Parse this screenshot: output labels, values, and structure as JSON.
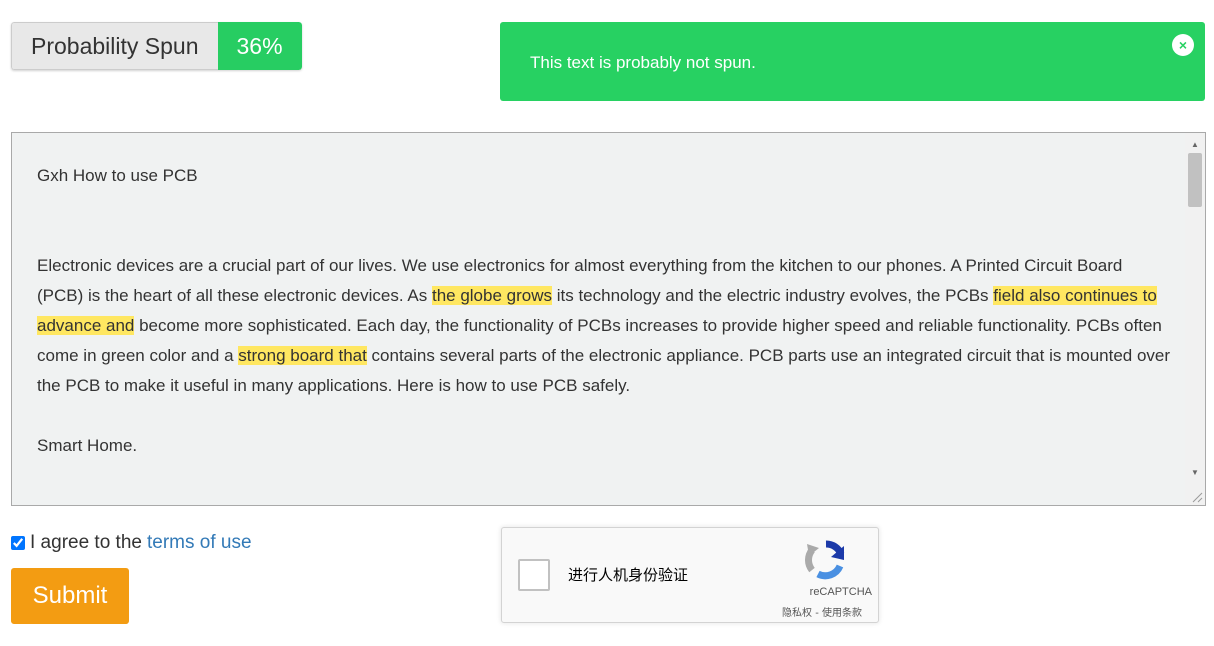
{
  "probability": {
    "label": "Probability Spun",
    "value": "36%"
  },
  "alert": {
    "message": "This text is probably not spun.",
    "close_symbol": "×",
    "color": "#27d162"
  },
  "textbox": {
    "title": "Gxh  How to use PCB",
    "paragraph_segments": [
      {
        "text": "Electronic devices are a crucial part of our lives. We use electronics for almost everything from the kitchen to our phones. A Printed Circuit Board (PCB) is the heart of all these electronic devices. As ",
        "highlight": false
      },
      {
        "text": "the globe grows",
        "highlight": true
      },
      {
        "text": " its technology and the electric industry evolves, the PCBs ",
        "highlight": false
      },
      {
        "text": "field also continues to advance and",
        "highlight": true
      },
      {
        "text": " become more sophisticated. Each day, the functionality of PCBs increases to provide higher speed and reliable functionality. PCBs often come in green color and a ",
        "highlight": false
      },
      {
        "text": "strong board that",
        "highlight": true
      },
      {
        "text": " contains several parts of the electronic appliance. PCB parts use an integrated circuit that is mounted over the PCB to make it useful in many applications. Here is how to use PCB safely.",
        "highlight": false
      }
    ],
    "last_line": "Smart Home.",
    "highlight_color": "#ffe761"
  },
  "agree": {
    "text": "I agree to the",
    "link_text": "terms of use",
    "checked": true
  },
  "submit": {
    "label": "Submit",
    "color": "#f39c12"
  },
  "recaptcha": {
    "label": "进行人机身份验证",
    "brand": "reCAPTCHA",
    "links": "隐私权 - 使用条款"
  }
}
